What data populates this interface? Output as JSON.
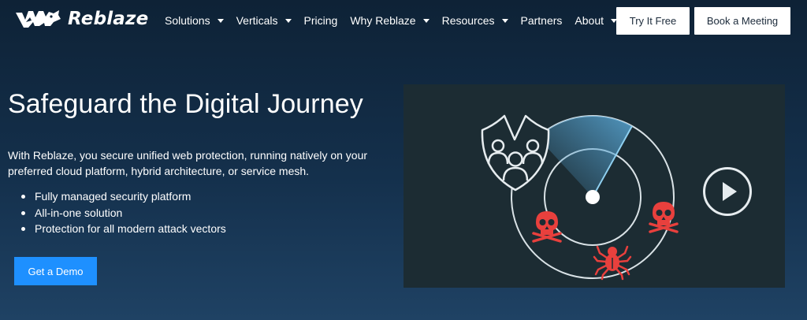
{
  "brand": {
    "name": "Reblaze"
  },
  "nav": {
    "items": [
      {
        "label": "Solutions",
        "has_dropdown": true
      },
      {
        "label": "Verticals",
        "has_dropdown": true
      },
      {
        "label": "Pricing",
        "has_dropdown": false
      },
      {
        "label": "Why Reblaze",
        "has_dropdown": true
      },
      {
        "label": "Resources",
        "has_dropdown": true
      },
      {
        "label": "Partners",
        "has_dropdown": false
      },
      {
        "label": "About",
        "has_dropdown": true
      }
    ],
    "cta_try": "Try It Free",
    "cta_meeting": "Book a Meeting"
  },
  "hero": {
    "title": "Safeguard the Digital Journey",
    "description": "With Reblaze, you secure unified web protection, running natively on your preferred cloud platform, hybrid architecture, or service mesh.",
    "bullets": [
      "Fully managed security platform",
      "All-in-one solution",
      "Protection for all modern attack vectors"
    ],
    "cta": "Get a Demo"
  },
  "visual": {
    "icons": [
      "shield-users-icon",
      "radar-icon",
      "skull-icon",
      "skull-icon",
      "spider-icon",
      "play-icon"
    ]
  },
  "colors": {
    "background_top": "#0e2236",
    "background_bottom": "#1f4264",
    "accent_blue": "#1e90ff",
    "panel": "#1c2c33",
    "threat_red": "#e8403d"
  }
}
